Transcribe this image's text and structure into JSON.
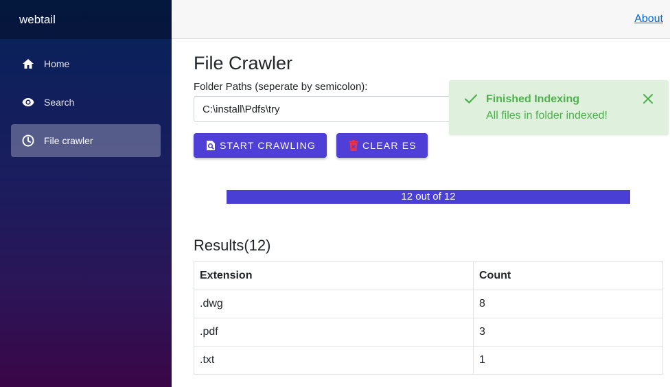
{
  "app": {
    "brand": "webtail"
  },
  "topbar": {
    "about_link": "About"
  },
  "sidebar": {
    "items": [
      {
        "label": "Home",
        "icon": "home-icon",
        "active": false
      },
      {
        "label": "Search",
        "icon": "eye-icon",
        "active": false
      },
      {
        "label": "File crawler",
        "icon": "clock-icon",
        "active": true
      }
    ]
  },
  "main": {
    "title": "File Crawler",
    "folder_label": "Folder Paths (seperate by semicolon):",
    "folder_value": "C:\\install\\Pdfs\\try",
    "start_button": "START CRAWLING",
    "clear_button": "CLEAR ES",
    "progress": {
      "text": "12 out of 12",
      "fraction": 1.0
    },
    "results_title": "Results(12)",
    "table": {
      "headers": [
        "Extension",
        "Count"
      ],
      "rows": [
        [
          ".dwg",
          "8"
        ],
        [
          ".pdf",
          "3"
        ],
        [
          ".txt",
          "1"
        ]
      ]
    }
  },
  "toast": {
    "title": "Finished Indexing",
    "message": "All files in folder indexed!",
    "color": "#4db04d"
  },
  "colors": {
    "accent": "#4f3fd6",
    "link": "#0366d6"
  }
}
